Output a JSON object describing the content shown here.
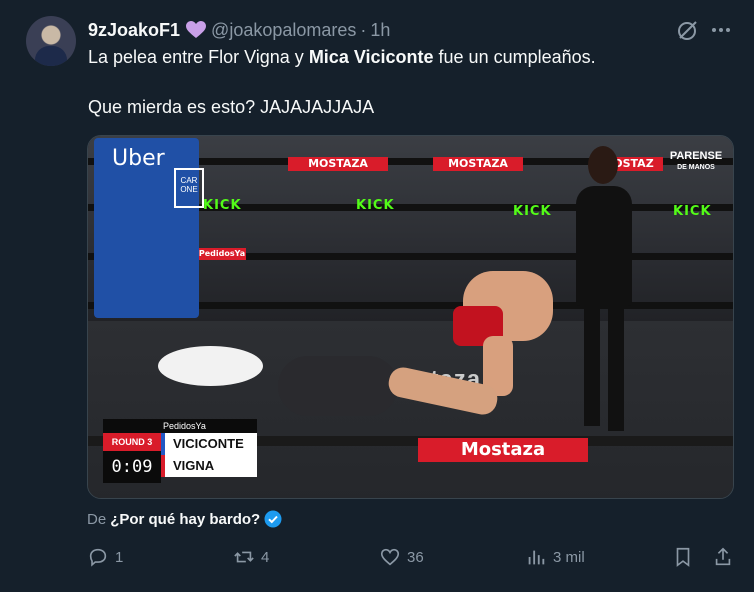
{
  "author": {
    "display_name": "9zJoakoF1",
    "handle": "@joakopalomares",
    "separator": "·",
    "time": "1h"
  },
  "tweet": {
    "line1_a": "La pelea entre Flor Vigna y ",
    "line1_bold": "Mica Viciconte",
    "line1_b": " fue un cumpleaños.",
    "line2": "Que mierda es esto? JAJAJAJJAJA"
  },
  "media": {
    "corner_brand": "Uber",
    "corner_sign": "CAR ONE",
    "banners": {
      "mostaza_1": "MOSTAZA",
      "mostaza_2": "MOSTAZA",
      "mostaza_3": "MOSTAZ",
      "kick_1": "KICK",
      "kick_2": "KICK",
      "kick_3": "KICK",
      "kick_4": "KICK",
      "pedidosya": "PedidosYa",
      "mostaza_floor": "Mostaza",
      "floor": "mostaza"
    },
    "show_logo": "PARENSE",
    "show_logo_sub": "DE MANOS",
    "scoreboard": {
      "brand": "PedidosYa",
      "round": "ROUND 3",
      "clock": "0:09",
      "fighter_1": "VICICONTE",
      "fighter_2": "VIGNA",
      "fighter_1_color": "#2158c4",
      "fighter_2_color": "#d91c2a"
    }
  },
  "via": {
    "prefix": "De",
    "source": "¿Por qué hay bardo?"
  },
  "actions": {
    "replies": "1",
    "reposts": "4",
    "likes": "36",
    "views": "3 mil"
  },
  "colors": {
    "background": "#15202b",
    "muted": "#8b98a5",
    "accent": "#1d9bf0",
    "heart": "#c9a0e8"
  }
}
